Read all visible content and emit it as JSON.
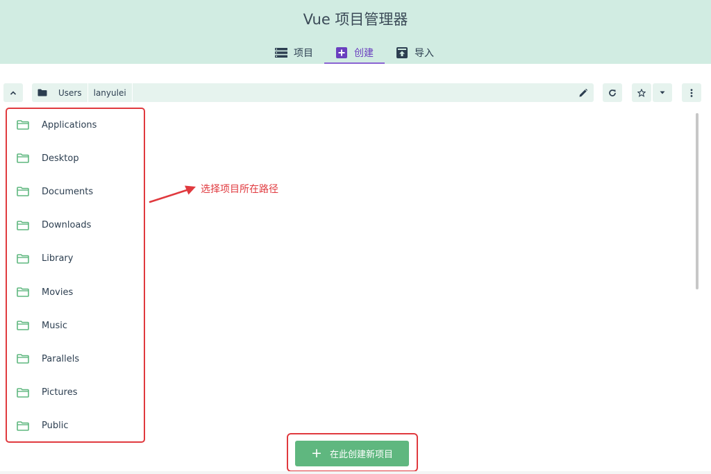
{
  "header": {
    "title": "Vue 项目管理器",
    "tabs": [
      {
        "label": "项目",
        "icon": "list-icon",
        "active": false
      },
      {
        "label": "创建",
        "icon": "plus-box-icon",
        "active": true
      },
      {
        "label": "导入",
        "icon": "import-icon",
        "active": false
      }
    ]
  },
  "path": {
    "crumbs": [
      "Users",
      "lanyulei"
    ]
  },
  "folders": [
    "Applications",
    "Desktop",
    "Documents",
    "Downloads",
    "Library",
    "Movies",
    "Music",
    "Parallels",
    "Pictures",
    "Public"
  ],
  "annotation": "选择项目所在路径",
  "create_button": "在此创建新项目",
  "colors": {
    "header_bg": "#d1ece2",
    "accent_purple": "#6a3fbf",
    "folder_green": "#5fb77f",
    "annotation_red": "#e0393e"
  }
}
